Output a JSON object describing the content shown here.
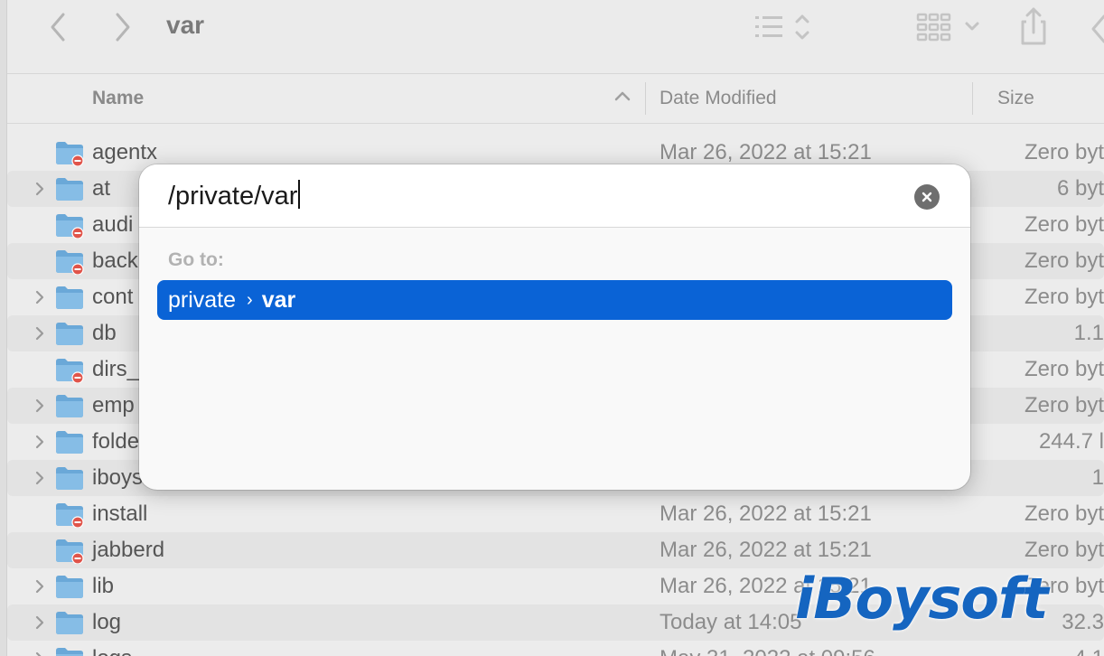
{
  "toolbar": {
    "title": "var",
    "icons": [
      "chevron-left-icon",
      "chevron-right-icon",
      "list-view-icon",
      "grid-view-icon",
      "share-icon"
    ]
  },
  "columns": {
    "name": "Name",
    "date": "Date Modified",
    "size": "Size"
  },
  "rows": [
    {
      "name": "agentx",
      "date": "Mar 26, 2022 at 15:21",
      "size": "Zero byt",
      "restricted": true,
      "expandable": false
    },
    {
      "name": "at",
      "date": "",
      "size": "6 byt",
      "restricted": false,
      "expandable": true
    },
    {
      "name": "audi",
      "date": "",
      "size": "Zero byt",
      "restricted": true,
      "expandable": false
    },
    {
      "name": "back",
      "date": "",
      "size": "Zero byt",
      "restricted": true,
      "expandable": false
    },
    {
      "name": "cont",
      "date": "",
      "size": "Zero byt",
      "restricted": false,
      "expandable": true
    },
    {
      "name": "db",
      "date": "",
      "size": "1.1",
      "restricted": false,
      "expandable": true
    },
    {
      "name": "dirs_",
      "date": "",
      "size": "Zero byt",
      "restricted": true,
      "expandable": false
    },
    {
      "name": "emp",
      "date": "",
      "size": "Zero byt",
      "restricted": false,
      "expandable": true
    },
    {
      "name": "folde",
      "date": "",
      "size": "244.7 l",
      "restricted": false,
      "expandable": true
    },
    {
      "name": "iboys",
      "date": "",
      "size": "1",
      "restricted": false,
      "expandable": true
    },
    {
      "name": "install",
      "date": "Mar 26, 2022 at 15:21",
      "size": "Zero byt",
      "restricted": true,
      "expandable": false
    },
    {
      "name": "jabberd",
      "date": "Mar 26, 2022 at 15:21",
      "size": "Zero byt",
      "restricted": true,
      "expandable": false
    },
    {
      "name": "lib",
      "date": "Mar 26, 2022 at 15:21",
      "size": "Zero byt",
      "restricted": false,
      "expandable": true
    },
    {
      "name": "log",
      "date": "Today at 14:05",
      "size": "32.3",
      "restricted": false,
      "expandable": true
    },
    {
      "name": "logs",
      "date": "May 31, 2022 at 09:56",
      "size": "4.1",
      "restricted": false,
      "expandable": true
    }
  ],
  "dialog": {
    "path_value": "/private/var",
    "goto_label": "Go to:",
    "suggestion": {
      "parent": "private",
      "separator": "›",
      "current": "var"
    }
  },
  "watermark": "iBoysoft",
  "colors": {
    "accent": "#0a63d6",
    "folder": "#6aa8d8",
    "restricted_badge": "#e0544a"
  }
}
